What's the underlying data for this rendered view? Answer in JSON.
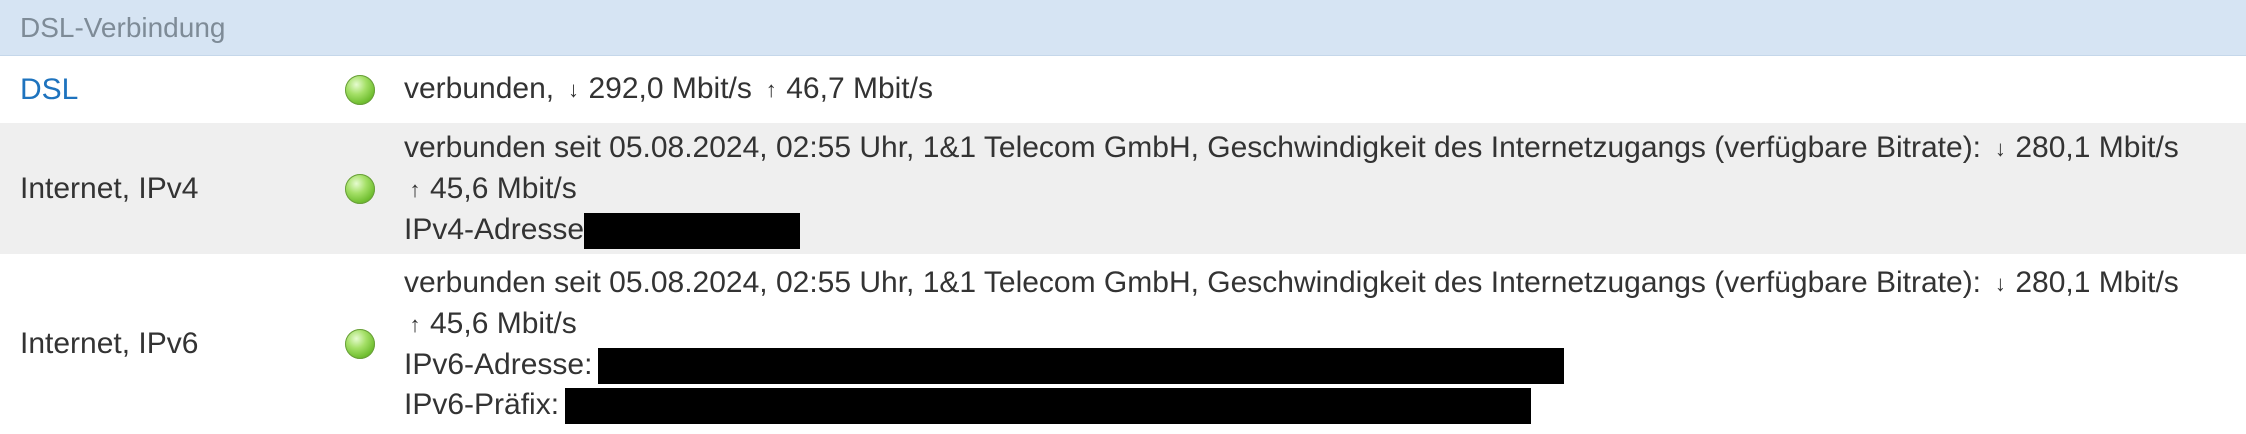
{
  "section": {
    "title": "DSL-Verbindung"
  },
  "colors": {
    "header_bg": "#d6e4f3",
    "link": "#1e73be",
    "led": "#7cc542",
    "row_alt": "#efefef"
  },
  "rows": {
    "dsl": {
      "label": "DSL",
      "status_prefix": "verbunden,",
      "down_arrow": "↓",
      "down": "292,0 Mbit/s",
      "up_arrow": "↑",
      "up": "46,7 Mbit/s"
    },
    "ipv4": {
      "label": "Internet, IPv4",
      "status_text": "verbunden seit 05.08.2024, 02:55 Uhr, 1&1 Telecom GmbH, Geschwindigkeit des Internetzugangs (verfügbare Bitrate):",
      "down_arrow": "↓",
      "down": "280,1 Mbit/s",
      "up_arrow": "↑",
      "up": "45,6 Mbit/s",
      "address_label": "IPv4-Adresse"
    },
    "ipv6": {
      "label": "Internet, IPv6",
      "status_text": "verbunden seit 05.08.2024, 02:55 Uhr, 1&1 Telecom GmbH, Geschwindigkeit des Internetzugangs (verfügbare Bitrate):",
      "down_arrow": "↓",
      "down": "280,1 Mbit/s",
      "up_arrow": "↑",
      "up": "45,6 Mbit/s",
      "address_label": "IPv6-Adresse:",
      "prefix_label": "IPv6-Präfix:"
    }
  }
}
